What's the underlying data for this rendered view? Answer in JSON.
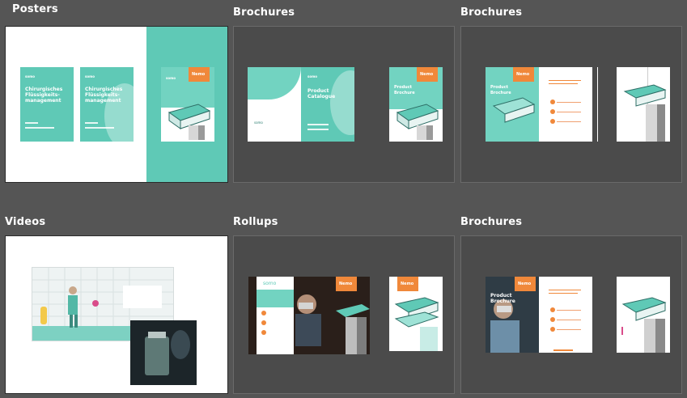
{
  "gallery": {
    "categories": [
      {
        "label": "Posters"
      },
      {
        "label": "Brochures"
      },
      {
        "label": "Brochures"
      },
      {
        "label": "Videos"
      },
      {
        "label": "Rollups"
      },
      {
        "label": "Brochures"
      }
    ]
  },
  "posters": {
    "poster1_title": "Chirurgisches Flüssigkeits-management",
    "poster2_title": "Chirurgisches Flüssigkeits-management",
    "brand": "somo",
    "badge": "Nemo"
  },
  "brochure1": {
    "title": "Product Catalogue",
    "back_title": "Product Brochure",
    "brand": "somo",
    "badge": "Nemo"
  },
  "brochure2": {
    "title": "Product Brochure",
    "badge": "Nemo"
  },
  "rollup": {
    "brand": "somo",
    "badge": "Nemo"
  },
  "brochure3": {
    "title": "Product Brochure",
    "badge": "Nemo"
  }
}
